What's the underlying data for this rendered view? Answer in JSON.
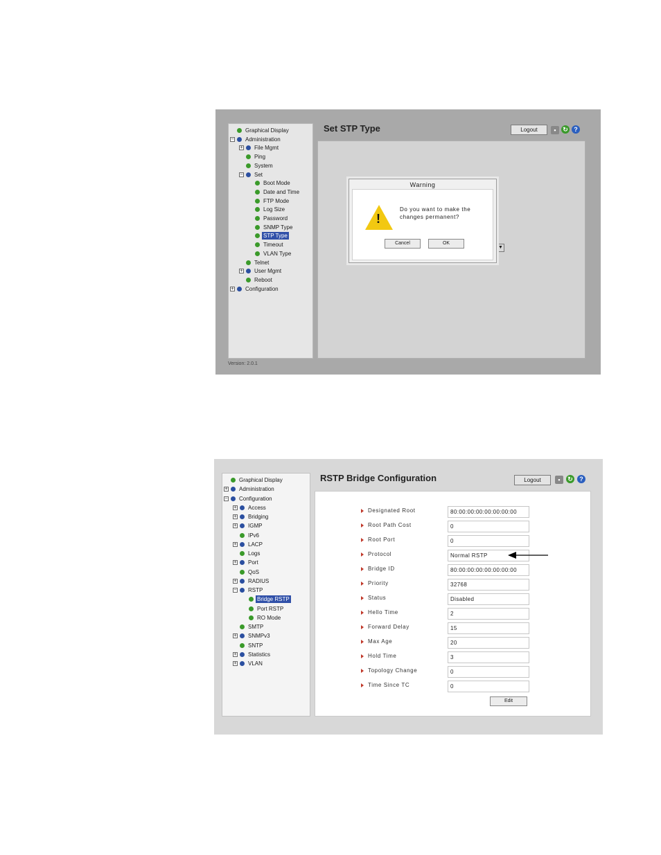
{
  "screen1": {
    "title": "Set STP Type",
    "logout": "Logout",
    "version": "Version: 2.0.1",
    "tree": [
      {
        "label": "Graphical Display",
        "level": 0,
        "expander": "",
        "dot": "green",
        "selected": false
      },
      {
        "label": "Administration",
        "level": 0,
        "expander": "−",
        "dot": "blue",
        "selected": false
      },
      {
        "label": "File Mgmt",
        "level": 1,
        "expander": "+",
        "dot": "blue",
        "selected": false
      },
      {
        "label": "Ping",
        "level": 1,
        "expander": "",
        "dot": "green",
        "selected": false
      },
      {
        "label": "System",
        "level": 1,
        "expander": "",
        "dot": "green",
        "selected": false
      },
      {
        "label": "Set",
        "level": 1,
        "expander": "−",
        "dot": "blue",
        "selected": false
      },
      {
        "label": "Boot Mode",
        "level": 2,
        "expander": "",
        "dot": "green",
        "selected": false
      },
      {
        "label": "Date and Time",
        "level": 2,
        "expander": "",
        "dot": "green",
        "selected": false
      },
      {
        "label": "FTP Mode",
        "level": 2,
        "expander": "",
        "dot": "green",
        "selected": false
      },
      {
        "label": "Log Size",
        "level": 2,
        "expander": "",
        "dot": "green",
        "selected": false
      },
      {
        "label": "Password",
        "level": 2,
        "expander": "",
        "dot": "green",
        "selected": false
      },
      {
        "label": "SNMP Type",
        "level": 2,
        "expander": "",
        "dot": "green",
        "selected": false
      },
      {
        "label": "STP Type",
        "level": 2,
        "expander": "",
        "dot": "green",
        "selected": true
      },
      {
        "label": "Timeout",
        "level": 2,
        "expander": "",
        "dot": "green",
        "selected": false
      },
      {
        "label": "VLAN Type",
        "level": 2,
        "expander": "",
        "dot": "green",
        "selected": false
      },
      {
        "label": "Telnet",
        "level": 1,
        "expander": "",
        "dot": "green",
        "selected": false
      },
      {
        "label": "User Mgmt",
        "level": 1,
        "expander": "+",
        "dot": "blue",
        "selected": false
      },
      {
        "label": "Reboot",
        "level": 1,
        "expander": "",
        "dot": "green",
        "selected": false
      },
      {
        "label": "Configuration",
        "level": 0,
        "expander": "+",
        "dot": "blue",
        "selected": false
      }
    ],
    "dialog": {
      "title": "Warning",
      "message": "Do you want to make the changes permanent?",
      "cancel": "Cancel",
      "ok": "OK"
    }
  },
  "screen2": {
    "title": "RSTP Bridge Configuration",
    "logout": "Logout",
    "tree": [
      {
        "label": "Graphical Display",
        "level": 0,
        "expander": "",
        "dot": "green",
        "selected": false
      },
      {
        "label": "Administration",
        "level": 0,
        "expander": "+",
        "dot": "blue",
        "selected": false
      },
      {
        "label": "Configuration",
        "level": 0,
        "expander": "−",
        "dot": "blue",
        "selected": false
      },
      {
        "label": "Access",
        "level": 1,
        "expander": "+",
        "dot": "blue",
        "selected": false
      },
      {
        "label": "Bridging",
        "level": 1,
        "expander": "+",
        "dot": "blue",
        "selected": false
      },
      {
        "label": "IGMP",
        "level": 1,
        "expander": "+",
        "dot": "blue",
        "selected": false
      },
      {
        "label": "IPv6",
        "level": 1,
        "expander": "",
        "dot": "green",
        "selected": false
      },
      {
        "label": "LACP",
        "level": 1,
        "expander": "+",
        "dot": "blue",
        "selected": false
      },
      {
        "label": "Logs",
        "level": 1,
        "expander": "",
        "dot": "green",
        "selected": false
      },
      {
        "label": "Port",
        "level": 1,
        "expander": "+",
        "dot": "blue",
        "selected": false
      },
      {
        "label": "QoS",
        "level": 1,
        "expander": "",
        "dot": "green",
        "selected": false
      },
      {
        "label": "RADIUS",
        "level": 1,
        "expander": "+",
        "dot": "blue",
        "selected": false
      },
      {
        "label": "RSTP",
        "level": 1,
        "expander": "−",
        "dot": "blue",
        "selected": false
      },
      {
        "label": "Bridge RSTP",
        "level": 2,
        "expander": "",
        "dot": "green",
        "selected": true
      },
      {
        "label": "Port RSTP",
        "level": 2,
        "expander": "",
        "dot": "green",
        "selected": false
      },
      {
        "label": "RO Mode",
        "level": 2,
        "expander": "",
        "dot": "green",
        "selected": false
      },
      {
        "label": "SMTP",
        "level": 1,
        "expander": "",
        "dot": "green",
        "selected": false
      },
      {
        "label": "SNMPv3",
        "level": 1,
        "expander": "+",
        "dot": "blue",
        "selected": false
      },
      {
        "label": "SNTP",
        "level": 1,
        "expander": "",
        "dot": "green",
        "selected": false
      },
      {
        "label": "Statistics",
        "level": 1,
        "expander": "+",
        "dot": "blue",
        "selected": false
      },
      {
        "label": "VLAN",
        "level": 1,
        "expander": "+",
        "dot": "blue",
        "selected": false
      }
    ],
    "fields": [
      {
        "label": "Designated Root",
        "value": "80:00:00:00:00:00:00:00"
      },
      {
        "label": "Root Path Cost",
        "value": "0"
      },
      {
        "label": "Root Port",
        "value": "0"
      },
      {
        "label": "Protocol",
        "value": "Normal RSTP"
      },
      {
        "label": "Bridge ID",
        "value": "80:00:00:00:00:00:00:00"
      },
      {
        "label": "Priority",
        "value": "32768"
      },
      {
        "label": "Status",
        "value": "Disabled"
      },
      {
        "label": "Hello Time",
        "value": "2"
      },
      {
        "label": "Forward Delay",
        "value": "15"
      },
      {
        "label": "Max Age",
        "value": "20"
      },
      {
        "label": "Hold Time",
        "value": "3"
      },
      {
        "label": "Topology Change",
        "value": "0"
      },
      {
        "label": "Time Since TC",
        "value": "0"
      }
    ],
    "edit": "Edit"
  },
  "icons": [
    "save-icon",
    "refresh-icon",
    "help-icon",
    "warning-icon",
    "arrow-icon"
  ],
  "colors": {
    "selected": "#3050a8",
    "bullet": "#c0392b",
    "refresh": "#3a9a2a",
    "help": "#2b5fbf",
    "warning": "#f2c811"
  }
}
